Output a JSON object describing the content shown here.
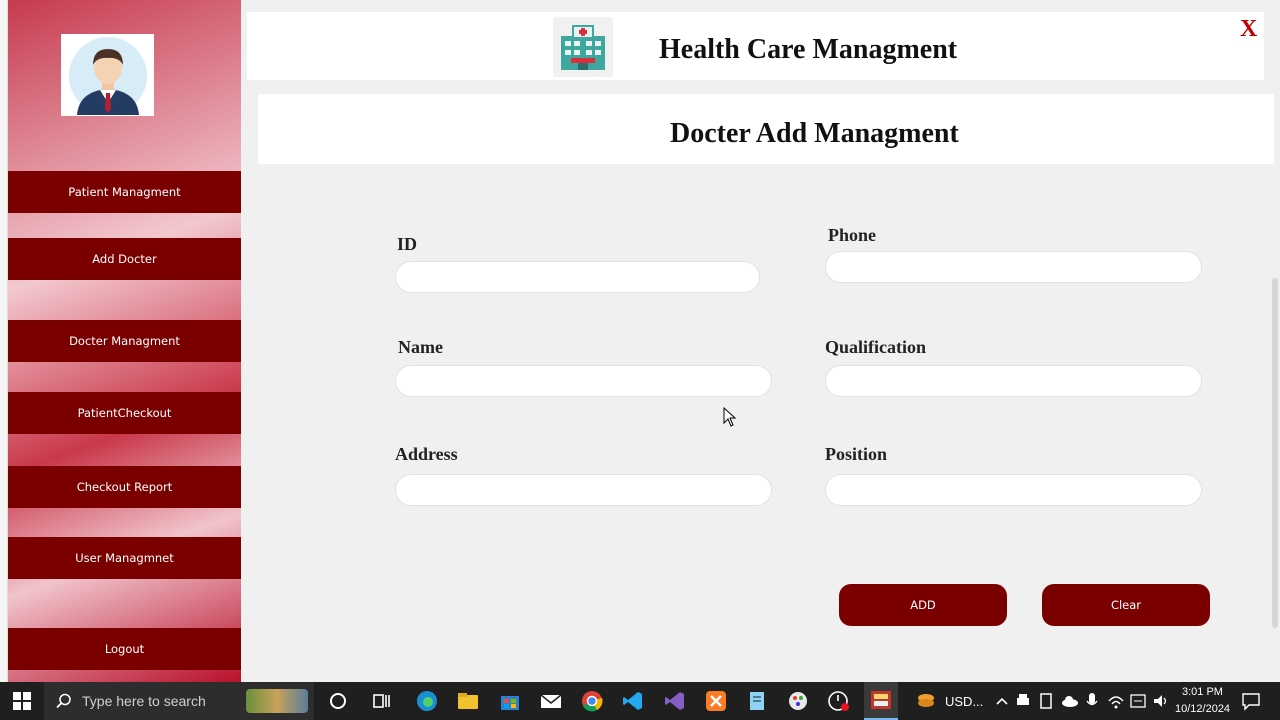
{
  "app": {
    "title": "Health Care Managment",
    "close_label": "X"
  },
  "sidebar": {
    "items": [
      {
        "label": "Patient Managment"
      },
      {
        "label": "Add Docter"
      },
      {
        "label": "Docter Managment"
      },
      {
        "label": "PatientCheckout"
      },
      {
        "label": "Checkout Report"
      },
      {
        "label": "User Managmnet"
      },
      {
        "label": "Logout"
      }
    ]
  },
  "page": {
    "title": "Docter Add Managment"
  },
  "form": {
    "id_label": "ID",
    "id_value": "",
    "phone_label": "Phone",
    "phone_value": "",
    "name_label": "Name",
    "name_value": "",
    "qualification_label": "Qualification",
    "qualification_value": "",
    "address_label": "Address",
    "address_value": "",
    "position_label": "Position",
    "position_value": ""
  },
  "actions": {
    "add_label": "ADD",
    "clear_label": "Clear"
  },
  "taskbar": {
    "search_placeholder": "Type here to search",
    "tray_currency": "USD...",
    "time": "3:01 PM",
    "date": "10/12/2024"
  },
  "colors": {
    "accent": "#7a0000",
    "close": "#c00000",
    "taskbar": "#1f1f1f"
  }
}
